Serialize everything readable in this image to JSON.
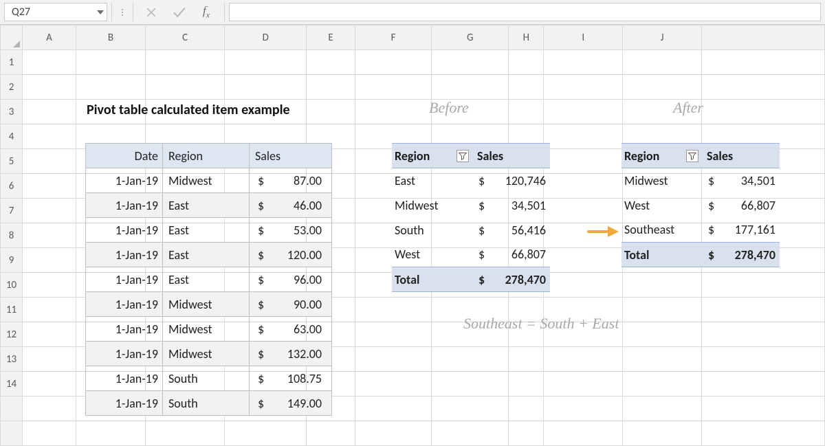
{
  "nameBox": "Q27",
  "formula": "",
  "columns": {
    "A": 86,
    "B": 112,
    "C": 128,
    "D": 132,
    "E": 78,
    "F": 124,
    "G": 124,
    "H": 56,
    "I": 128,
    "J": 128
  },
  "rowsShown": 14,
  "title": "Pivot table calculated item example",
  "labels": {
    "before": "Before",
    "after": "After",
    "note": "Southeast = South + East"
  },
  "dataTable": {
    "headers": [
      "Date",
      "Region",
      "Sales"
    ],
    "rows": [
      {
        "date": "1-Jan-19",
        "region": "Midwest",
        "sales": "87.00"
      },
      {
        "date": "1-Jan-19",
        "region": "East",
        "sales": "46.00"
      },
      {
        "date": "1-Jan-19",
        "region": "East",
        "sales": "53.00"
      },
      {
        "date": "1-Jan-19",
        "region": "East",
        "sales": "120.00"
      },
      {
        "date": "1-Jan-19",
        "region": "East",
        "sales": "96.00"
      },
      {
        "date": "1-Jan-19",
        "region": "Midwest",
        "sales": "90.00"
      },
      {
        "date": "1-Jan-19",
        "region": "Midwest",
        "sales": "63.00"
      },
      {
        "date": "1-Jan-19",
        "region": "Midwest",
        "sales": "132.00"
      },
      {
        "date": "1-Jan-19",
        "region": "South",
        "sales": "108.75"
      },
      {
        "date": "1-Jan-19",
        "region": "South",
        "sales": "149.00"
      }
    ]
  },
  "pivotBefore": {
    "headers": [
      "Region",
      "Sales"
    ],
    "rows": [
      {
        "label": "East",
        "value": "120,746"
      },
      {
        "label": "Midwest",
        "value": "34,501"
      },
      {
        "label": "South",
        "value": "56,416"
      },
      {
        "label": "West",
        "value": "66,807"
      }
    ],
    "total": {
      "label": "Total",
      "value": "278,470"
    }
  },
  "pivotAfter": {
    "headers": [
      "Region",
      "Sales"
    ],
    "rows": [
      {
        "label": "Midwest",
        "value": "34,501"
      },
      {
        "label": "West",
        "value": "66,807"
      },
      {
        "label": "Southeast",
        "value": "177,161"
      }
    ],
    "total": {
      "label": "Total",
      "value": "278,470"
    }
  },
  "chart_data": {
    "type": "table",
    "title": "Pivot table calculated item example",
    "pivot_before": {
      "categories": [
        "East",
        "Midwest",
        "South",
        "West"
      ],
      "values": [
        120746,
        34501,
        56416,
        66807
      ],
      "total": 278470
    },
    "pivot_after": {
      "categories": [
        "Midwest",
        "West",
        "Southeast"
      ],
      "values": [
        34501,
        66807,
        177161
      ],
      "total": 278470,
      "calculated_item": {
        "name": "Southeast",
        "formula": "South + East"
      }
    }
  }
}
